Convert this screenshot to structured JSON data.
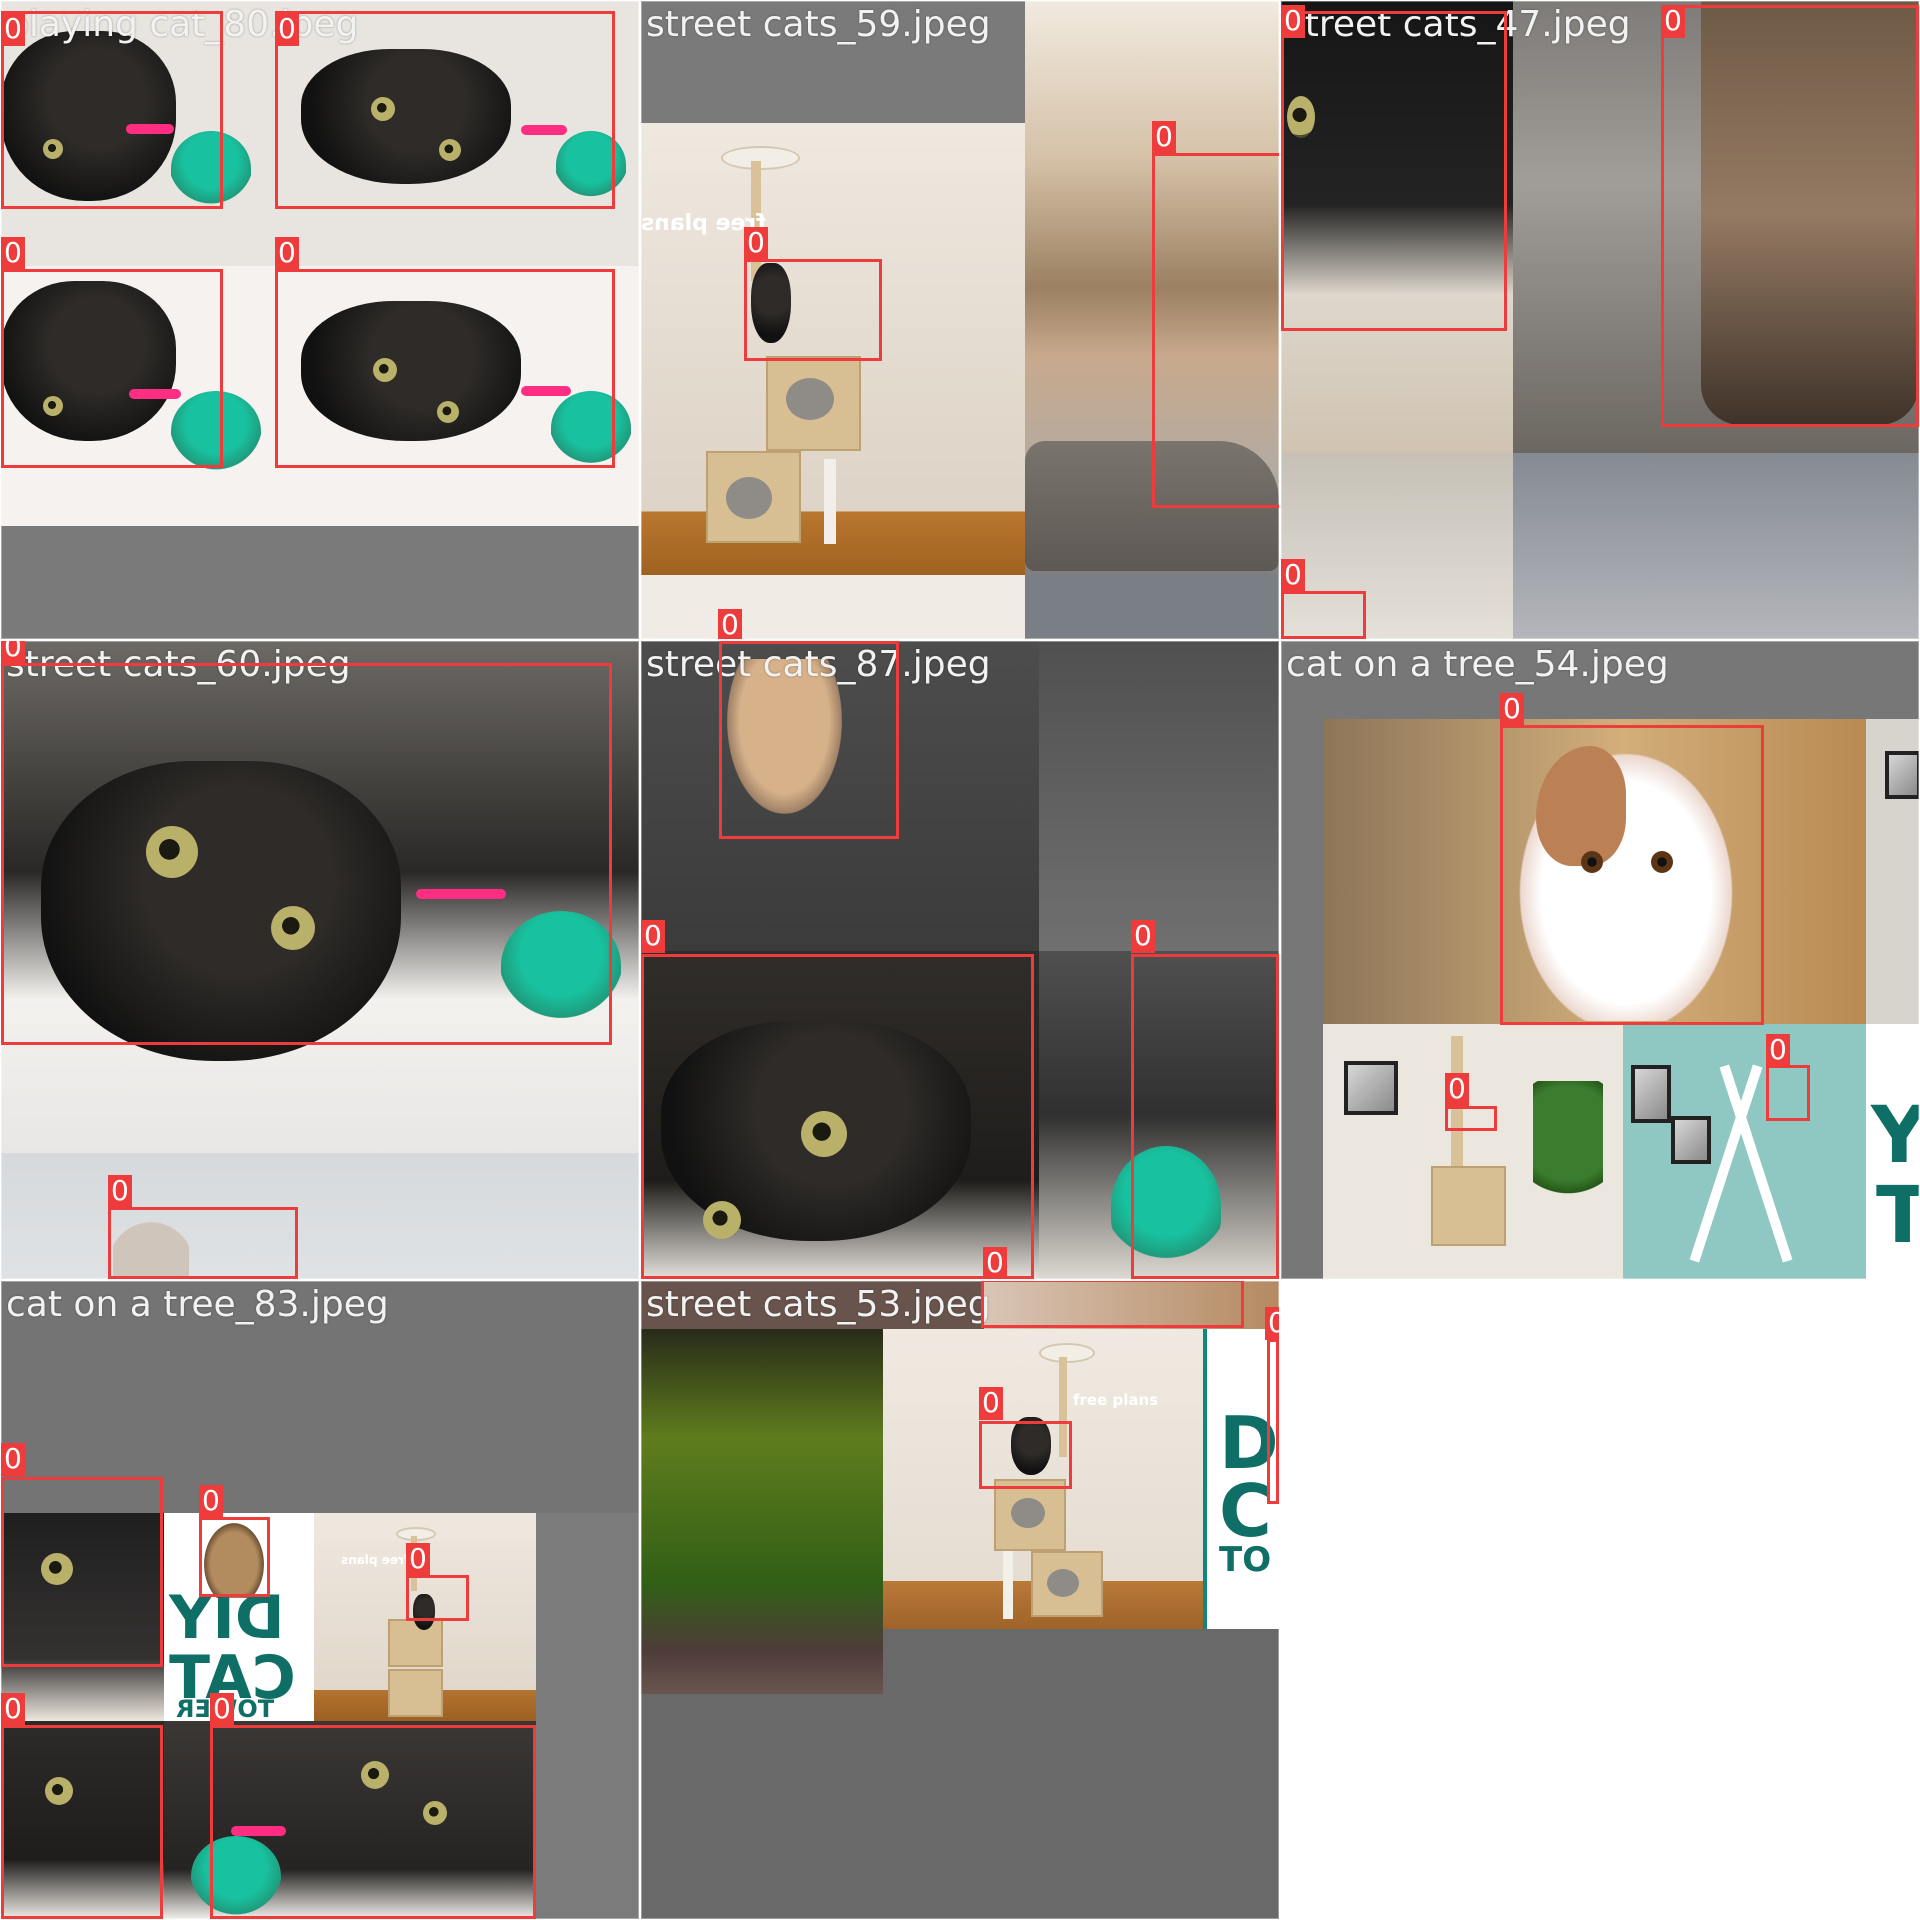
{
  "grid": {
    "background": "#ffffff",
    "tile_fill": "#6f6f6f",
    "box_color": "#ee3b3b"
  },
  "tiles": [
    {
      "id": "tile-1",
      "caption": "playing cat_80.jpeg",
      "labels": [
        "0",
        "0",
        "0",
        "0"
      ],
      "parts": []
    },
    {
      "id": "tile-2",
      "caption": "street cats_59.jpeg",
      "labels": [
        "0",
        "0",
        "0"
      ],
      "parts": [
        {
          "text": "free plans"
        }
      ]
    },
    {
      "id": "tile-3",
      "caption": "street cats_47.jpeg",
      "labels": [
        "0",
        "0",
        "0"
      ],
      "parts": []
    },
    {
      "id": "tile-4",
      "caption": "street cats_60.jpeg",
      "labels": [
        "0",
        "0"
      ],
      "parts": []
    },
    {
      "id": "tile-5",
      "caption": "street cats_87.jpeg",
      "labels": [
        "0",
        "0",
        "0",
        "0"
      ],
      "parts": []
    },
    {
      "id": "tile-6",
      "caption": "cat on a tree_54.jpeg",
      "labels": [
        "0",
        "0",
        "0"
      ],
      "parts": [
        {
          "text": "Y"
        },
        {
          "text": "T"
        }
      ]
    },
    {
      "id": "tile-7",
      "caption": "cat on a tree_83.jpeg",
      "labels": [
        "0",
        "0",
        "0",
        "0",
        "0"
      ],
      "parts": [
        {
          "text": "DIY"
        },
        {
          "text": "CAT"
        },
        {
          "text": "TOWER"
        },
        {
          "text": "free plans"
        }
      ]
    },
    {
      "id": "tile-8",
      "caption": "street cats_53.jpeg",
      "labels": [
        "0",
        "0",
        "0"
      ],
      "parts": [
        {
          "text": "free plans"
        },
        {
          "text": "D"
        },
        {
          "text": "C"
        },
        {
          "text": "TO"
        }
      ]
    }
  ]
}
